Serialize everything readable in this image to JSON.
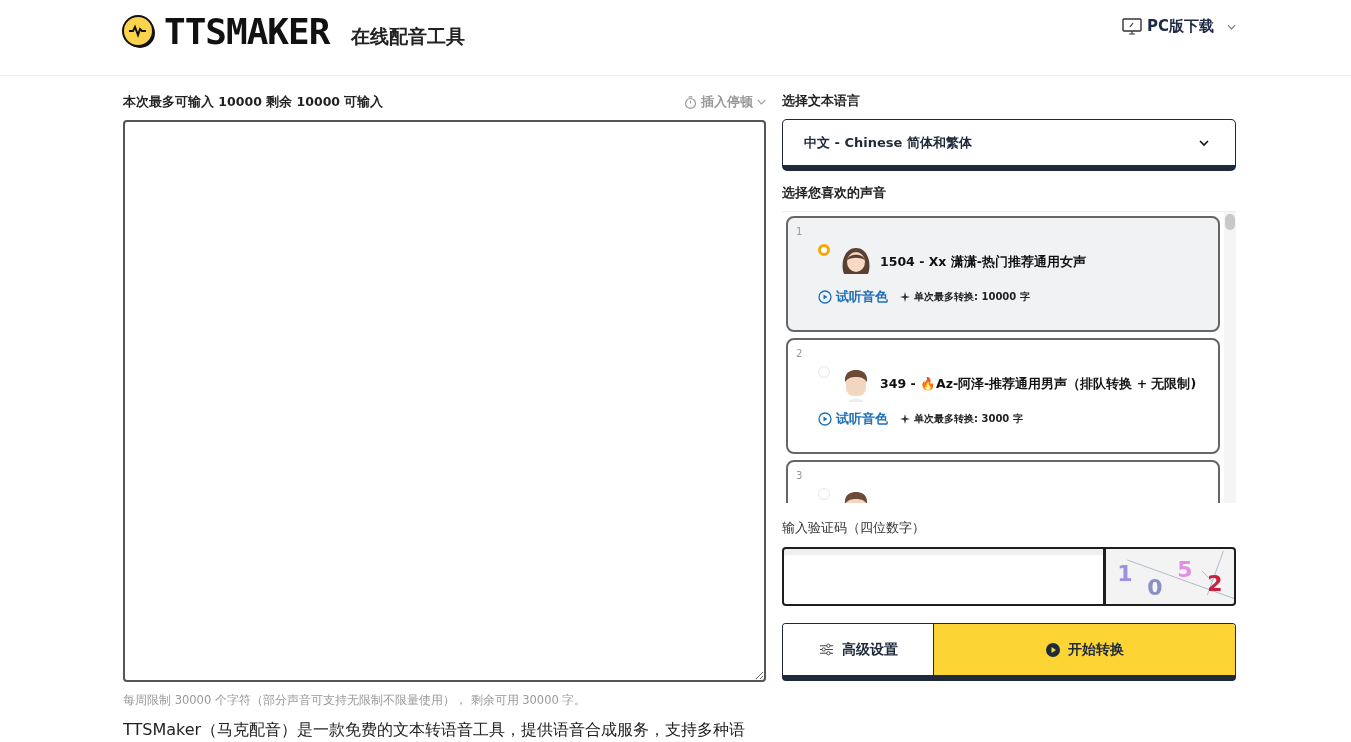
{
  "header": {
    "logo_text": "TTSMAKER",
    "tagline": "在线配音工具",
    "download": "PC版下载"
  },
  "editor": {
    "limit_label": "本次最多可输入 10000 剩余 10000 可输入",
    "pause_button": "插入停顿",
    "quota_note": "每周限制 30000 个字符（部分声音可支持无限制不限量使用），  剩余可用 30000 字。"
  },
  "language": {
    "label": "选择文本语言",
    "value": "中文 - Chinese 简体和繁体"
  },
  "voices": {
    "label": "选择您喜欢的声音",
    "items": [
      {
        "index": "1",
        "name": "1504 - Xx 潇潇-热门推荐通用女声",
        "selected": true,
        "kind": "female",
        "preview": "试听音色",
        "limit": "单次最多转换: 10000 字"
      },
      {
        "index": "2",
        "name": "349 - 🔥Az-阿泽-推荐通用男声（排队转换 + 无限制)",
        "selected": false,
        "kind": "male",
        "preview": "试听音色",
        "limit": "单次最多转换: 3000 字"
      },
      {
        "index": "3",
        "selected": false,
        "kind": "male"
      }
    ]
  },
  "captcha": {
    "label": "输入验证码（四位数字）",
    "digits": [
      {
        "text": "1",
        "color": "#9b8fe6"
      },
      {
        "text": "0",
        "color": "#8a8fc4"
      },
      {
        "text": "5",
        "color": "#e48de8"
      },
      {
        "text": "2",
        "color": "#c8203e"
      }
    ]
  },
  "actions": {
    "settings": "高级设置",
    "start": "开始转换"
  },
  "intro": "TTSMaker（马克配音）是一款免费的文本转语音工具，提供语音合成服务，支持多种语"
}
